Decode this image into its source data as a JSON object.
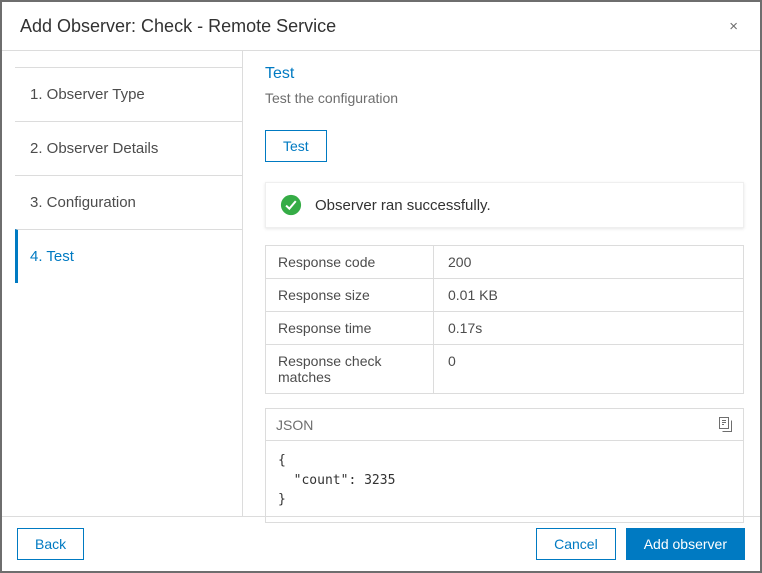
{
  "dialog": {
    "title": "Add Observer: Check - Remote Service",
    "close_glyph": "×"
  },
  "steps": [
    {
      "label": "1.  Observer Type",
      "active": false
    },
    {
      "label": "2.  Observer Details",
      "active": false
    },
    {
      "label": "3.  Configuration",
      "active": false
    },
    {
      "label": "4.  Test",
      "active": true
    }
  ],
  "main": {
    "heading": "Test",
    "subheading": "Test the configuration",
    "test_button_label": "Test",
    "success_message": "Observer ran successfully.",
    "results": [
      {
        "label": "Response code",
        "value": "200"
      },
      {
        "label": "Response size",
        "value": "0.01 KB"
      },
      {
        "label": "Response time",
        "value": "0.17s"
      },
      {
        "label": "Response check matches",
        "value": "0"
      }
    ],
    "json_panel": {
      "title": "JSON",
      "code": "{\n  \"count\": 3235\n}"
    }
  },
  "footer": {
    "back_label": "Back",
    "cancel_label": "Cancel",
    "submit_label": "Add observer"
  },
  "colors": {
    "accent": "#007ac2",
    "success": "#35ac46"
  }
}
